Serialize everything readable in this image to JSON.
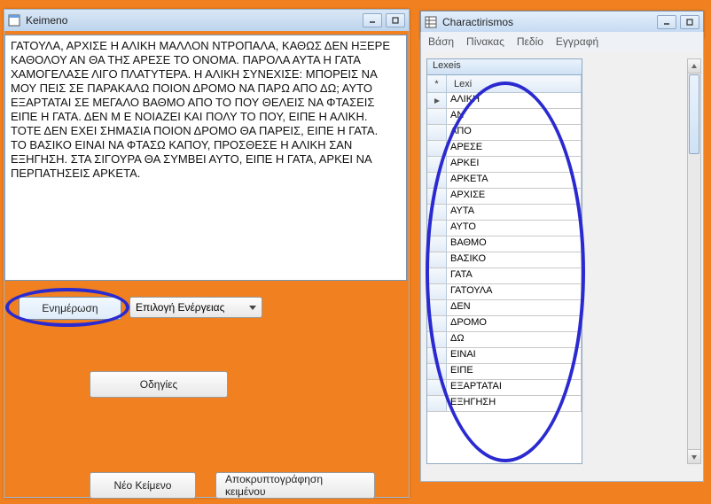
{
  "keimeno": {
    "title": "Keimeno",
    "text": "ΓΑΤΟΥΛΑ, ΑΡΧΙΣΕ Η ΑΛΙΚΗ ΜΑΛΛΟΝ ΝΤΡΟΠΑΛΑ, ΚΑΘΩΣ ΔΕΝ ΗΞΕΡΕ ΚΑΘΟΛΟΥ ΑΝ ΘΑ ΤΗΣ ΑΡΕΣΕ ΤΟ ΟΝΟΜΑ. ΠΑΡΟΛΑ ΑΥΤΑ Η ΓΑΤΑ ΧΑΜΟΓΕΛΑΣΕ ΛΙΓΟ ΠΛΑΤΥΤΕΡΑ. Η ΑΛΙΚΗ ΣΥΝΕΧΙΣΕ: ΜΠΟΡΕΙΣ ΝΑ ΜΟΥ ΠΕΙΣ ΣΕ ΠΑΡΑΚΑΛΩ ΠΟΙΟΝ ΔΡΟΜΟ ΝΑ ΠΑΡΩ ΑΠΟ ΔΩ; ΑΥΤΟ ΕΞΑΡΤΑΤΑΙ ΣΕ ΜΕΓΑΛΟ ΒΑΘΜΟ ΑΠΟ ΤΟ ΠΟΥ ΘΕΛΕΙΣ ΝΑ ΦΤΑΣΕΙΣ ΕΙΠΕ Η ΓΑΤΑ. ΔΕΝ Μ Ε ΝΟΙΑΖΕΙ ΚΑΙ ΠΟΛΥ ΤΟ ΠΟΥ, ΕΙΠΕ Η ΑΛΙΚΗ. ΤΟΤΕ ΔΕΝ ΕΧΕΙ ΣΗΜΑΣΙΑ ΠΟΙΟΝ ΔΡΟΜΟ ΘΑ ΠΑΡΕΙΣ, ΕΙΠΕ Η ΓΑΤΑ.\nΤΟ ΒΑΣΙΚΟ ΕΙΝΑΙ ΝΑ ΦΤΑΣΩ ΚΑΠΟΥ, ΠΡΟΣΘΕΣΕ Η ΑΛΙΚΗ ΣΑΝ ΕΞΗΓΗΣΗ. ΣΤΑ ΣΙΓΟΥΡΑ ΘΑ ΣΥΜΒΕΙ ΑΥΤΟ, ΕΙΠΕ Η ΓΑΤΑ, ΑΡΚΕΙ ΝΑ ΠΕΡΠΑΤΗΣΕΙΣ ΑΡΚΕΤΑ.",
    "buttons": {
      "enimerosi": "Ενημέρωση",
      "combo_label": "Επιλογή Ενέργειας",
      "odigies": "Οδηγίες",
      "neo_keimeno": "Νέο Κείμενο",
      "apokrypt": "Αποκρυπτογράφηση κειμένου"
    }
  },
  "char": {
    "title": "Charactirismos",
    "menu": {
      "basi": "Βάση",
      "pinakas": "Πίνακας",
      "pedio": "Πεδίο",
      "eggrafi": "Εγγραφή"
    },
    "subwin_title": "Lexeis",
    "newrow_marker": "*",
    "col_header": "Lexi",
    "rows": [
      "ΑΛΙΚΗ",
      "ΑΝ",
      "ΑΠΟ",
      "ΑΡΕΣΕ",
      "ΑΡΚΕΙ",
      "ΑΡΚΕΤΑ",
      "ΑΡΧΙΣΕ",
      "ΑΥΤΑ",
      "ΑΥΤΟ",
      "ΒΑΘΜΟ",
      "ΒΑΣΙΚΟ",
      "ΓΑΤΑ",
      "ΓΑΤΟΥΛΑ",
      "ΔΕΝ",
      "ΔΡΟΜΟ",
      "ΔΩ",
      "ΕΙΝΑΙ",
      "ΕΙΠΕ",
      "ΕΞΑΡΤΑΤΑΙ",
      "ΕΞΗΓΗΣΗ"
    ]
  }
}
